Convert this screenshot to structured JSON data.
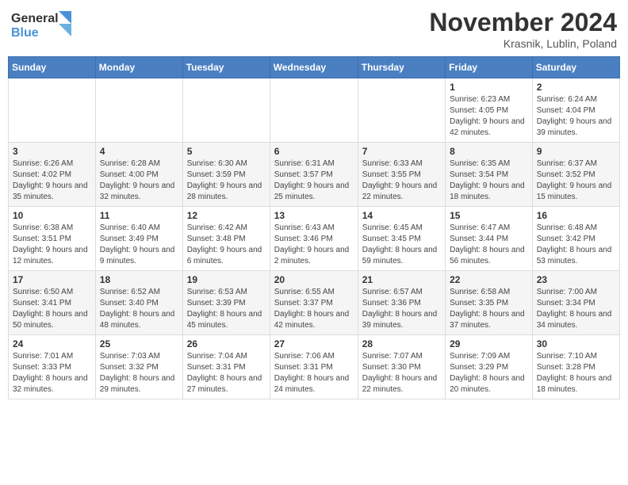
{
  "logo": {
    "line1": "General",
    "line2": "Blue"
  },
  "title": "November 2024",
  "location": "Krasnik, Lublin, Poland",
  "days_of_week": [
    "Sunday",
    "Monday",
    "Tuesday",
    "Wednesday",
    "Thursday",
    "Friday",
    "Saturday"
  ],
  "weeks": [
    [
      {
        "day": "",
        "info": ""
      },
      {
        "day": "",
        "info": ""
      },
      {
        "day": "",
        "info": ""
      },
      {
        "day": "",
        "info": ""
      },
      {
        "day": "",
        "info": ""
      },
      {
        "day": "1",
        "info": "Sunrise: 6:23 AM\nSunset: 4:05 PM\nDaylight: 9 hours and 42 minutes."
      },
      {
        "day": "2",
        "info": "Sunrise: 6:24 AM\nSunset: 4:04 PM\nDaylight: 9 hours and 39 minutes."
      }
    ],
    [
      {
        "day": "3",
        "info": "Sunrise: 6:26 AM\nSunset: 4:02 PM\nDaylight: 9 hours and 35 minutes."
      },
      {
        "day": "4",
        "info": "Sunrise: 6:28 AM\nSunset: 4:00 PM\nDaylight: 9 hours and 32 minutes."
      },
      {
        "day": "5",
        "info": "Sunrise: 6:30 AM\nSunset: 3:59 PM\nDaylight: 9 hours and 28 minutes."
      },
      {
        "day": "6",
        "info": "Sunrise: 6:31 AM\nSunset: 3:57 PM\nDaylight: 9 hours and 25 minutes."
      },
      {
        "day": "7",
        "info": "Sunrise: 6:33 AM\nSunset: 3:55 PM\nDaylight: 9 hours and 22 minutes."
      },
      {
        "day": "8",
        "info": "Sunrise: 6:35 AM\nSunset: 3:54 PM\nDaylight: 9 hours and 18 minutes."
      },
      {
        "day": "9",
        "info": "Sunrise: 6:37 AM\nSunset: 3:52 PM\nDaylight: 9 hours and 15 minutes."
      }
    ],
    [
      {
        "day": "10",
        "info": "Sunrise: 6:38 AM\nSunset: 3:51 PM\nDaylight: 9 hours and 12 minutes."
      },
      {
        "day": "11",
        "info": "Sunrise: 6:40 AM\nSunset: 3:49 PM\nDaylight: 9 hours and 9 minutes."
      },
      {
        "day": "12",
        "info": "Sunrise: 6:42 AM\nSunset: 3:48 PM\nDaylight: 9 hours and 6 minutes."
      },
      {
        "day": "13",
        "info": "Sunrise: 6:43 AM\nSunset: 3:46 PM\nDaylight: 9 hours and 2 minutes."
      },
      {
        "day": "14",
        "info": "Sunrise: 6:45 AM\nSunset: 3:45 PM\nDaylight: 8 hours and 59 minutes."
      },
      {
        "day": "15",
        "info": "Sunrise: 6:47 AM\nSunset: 3:44 PM\nDaylight: 8 hours and 56 minutes."
      },
      {
        "day": "16",
        "info": "Sunrise: 6:48 AM\nSunset: 3:42 PM\nDaylight: 8 hours and 53 minutes."
      }
    ],
    [
      {
        "day": "17",
        "info": "Sunrise: 6:50 AM\nSunset: 3:41 PM\nDaylight: 8 hours and 50 minutes."
      },
      {
        "day": "18",
        "info": "Sunrise: 6:52 AM\nSunset: 3:40 PM\nDaylight: 8 hours and 48 minutes."
      },
      {
        "day": "19",
        "info": "Sunrise: 6:53 AM\nSunset: 3:39 PM\nDaylight: 8 hours and 45 minutes."
      },
      {
        "day": "20",
        "info": "Sunrise: 6:55 AM\nSunset: 3:37 PM\nDaylight: 8 hours and 42 minutes."
      },
      {
        "day": "21",
        "info": "Sunrise: 6:57 AM\nSunset: 3:36 PM\nDaylight: 8 hours and 39 minutes."
      },
      {
        "day": "22",
        "info": "Sunrise: 6:58 AM\nSunset: 3:35 PM\nDaylight: 8 hours and 37 minutes."
      },
      {
        "day": "23",
        "info": "Sunrise: 7:00 AM\nSunset: 3:34 PM\nDaylight: 8 hours and 34 minutes."
      }
    ],
    [
      {
        "day": "24",
        "info": "Sunrise: 7:01 AM\nSunset: 3:33 PM\nDaylight: 8 hours and 32 minutes."
      },
      {
        "day": "25",
        "info": "Sunrise: 7:03 AM\nSunset: 3:32 PM\nDaylight: 8 hours and 29 minutes."
      },
      {
        "day": "26",
        "info": "Sunrise: 7:04 AM\nSunset: 3:31 PM\nDaylight: 8 hours and 27 minutes."
      },
      {
        "day": "27",
        "info": "Sunrise: 7:06 AM\nSunset: 3:31 PM\nDaylight: 8 hours and 24 minutes."
      },
      {
        "day": "28",
        "info": "Sunrise: 7:07 AM\nSunset: 3:30 PM\nDaylight: 8 hours and 22 minutes."
      },
      {
        "day": "29",
        "info": "Sunrise: 7:09 AM\nSunset: 3:29 PM\nDaylight: 8 hours and 20 minutes."
      },
      {
        "day": "30",
        "info": "Sunrise: 7:10 AM\nSunset: 3:28 PM\nDaylight: 8 hours and 18 minutes."
      }
    ]
  ]
}
